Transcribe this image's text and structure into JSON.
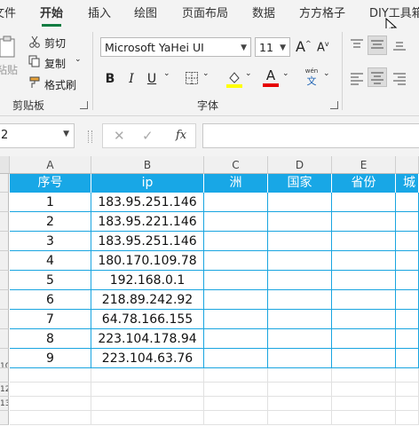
{
  "menu": {
    "tabs": [
      "文件",
      "开始",
      "插入",
      "绘图",
      "页面布局",
      "数据",
      "方方格子",
      "DIY工具箱"
    ],
    "active_tab": "开始"
  },
  "ribbon": {
    "clipboard": {
      "paste_label": "粘贴",
      "cut_label": "剪切",
      "copy_label": "复制",
      "format_painter_label": "格式刷",
      "group_label": "剪贴板"
    },
    "font": {
      "font_name": "Microsoft YaHei UI",
      "font_size": "11",
      "grow_label": "A",
      "shrink_label": "A",
      "bold_label": "B",
      "italic_label": "I",
      "underline_label": "U",
      "font_color_label": "A",
      "phonetic_top": "wén",
      "phonetic_bottom": "文",
      "group_label": "字体"
    }
  },
  "formula_bar": {
    "name_box": "2",
    "fx_label": "fx",
    "formula": ""
  },
  "sheet": {
    "column_letters": [
      "A",
      "B",
      "C",
      "D",
      "E"
    ],
    "headers": [
      "序号",
      "ip",
      "洲",
      "国家",
      "省份",
      "城"
    ],
    "rows": [
      [
        "1",
        "183.95.251.146"
      ],
      [
        "2",
        "183.95.221.146"
      ],
      [
        "3",
        "183.95.251.146"
      ],
      [
        "4",
        "180.170.109.78"
      ],
      [
        "5",
        "192.168.0.1"
      ],
      [
        "6",
        "218.89.242.92"
      ],
      [
        "7",
        "64.78.166.155"
      ],
      [
        "8",
        "223.104.178.94"
      ],
      [
        "9",
        "223.104.63.76"
      ]
    ],
    "row_numbers": [
      "10",
      "12",
      "13"
    ]
  },
  "colors": {
    "header_fill": "#18a7e6",
    "border": "#19a5e0",
    "accent": "#107c41"
  }
}
